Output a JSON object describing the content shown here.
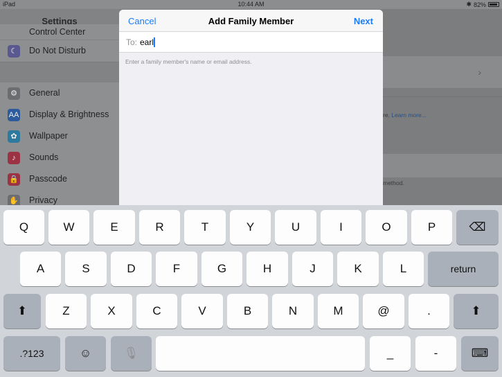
{
  "status_bar": {
    "device": "iPad",
    "time": "10:44 AM",
    "battery": "82%"
  },
  "settings": {
    "title": "Settings",
    "items": [
      {
        "label": "Control Center",
        "icon": "control-center-icon",
        "color": "#8a8a8e"
      },
      {
        "label": "Do Not Disturb",
        "icon": "moon-icon",
        "color": "#5856d6"
      },
      {
        "label": "General",
        "icon": "gear-icon",
        "color": "#8e8e93"
      },
      {
        "label": "Display & Brightness",
        "icon": "display-icon",
        "color": "#1b6fd9"
      },
      {
        "label": "Wallpaper",
        "icon": "wallpaper-icon",
        "color": "#35aadc"
      },
      {
        "label": "Sounds",
        "icon": "speaker-icon",
        "color": "#e5334b"
      },
      {
        "label": "Passcode",
        "icon": "lock-icon",
        "color": "#e5334b"
      },
      {
        "label": "Privacy",
        "icon": "hand-icon",
        "color": "#8e8e93"
      }
    ]
  },
  "background_right": {
    "text_a": "re.",
    "link": "Learn more...",
    "text_b": "method."
  },
  "modal": {
    "cancel": "Cancel",
    "title": "Add Family Member",
    "next": "Next",
    "to_label": "To:",
    "to_value": "earl",
    "hint": "Enter a family member's name or email address."
  },
  "keyboard": {
    "row1": [
      "Q",
      "W",
      "E",
      "R",
      "T",
      "Y",
      "U",
      "I",
      "O",
      "P"
    ],
    "row2": [
      "A",
      "S",
      "D",
      "F",
      "G",
      "H",
      "J",
      "K",
      "L"
    ],
    "row3": [
      "Z",
      "X",
      "C",
      "V",
      "B",
      "N",
      "M",
      "@",
      "."
    ],
    "return_label": "return",
    "numbers_label": ".?123",
    "emoji_icon": "☺",
    "mic_icon": "🎙",
    "underscore": "_",
    "dash": "-",
    "delete_icon": "⌫",
    "shift_icon": "⬆",
    "hide_icon": "⌨"
  },
  "colors": {
    "accent": "#1a7cf5"
  }
}
